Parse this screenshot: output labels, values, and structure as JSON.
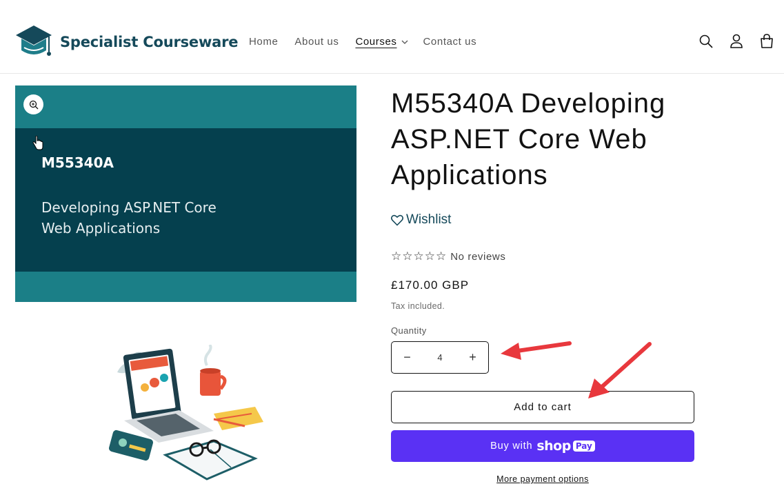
{
  "header": {
    "brand": "Specialist Courseware",
    "nav": [
      {
        "label": "Home"
      },
      {
        "label": "About us"
      },
      {
        "label": "Courses"
      },
      {
        "label": "Contact us"
      }
    ],
    "icons": [
      "search-icon",
      "account-icon",
      "cart-icon"
    ]
  },
  "media": {
    "course_code": "M55340A",
    "course_title": "Developing ASP.NET Core Web Applications",
    "colors": {
      "outer": "#1b7f87",
      "band": "#05404e"
    }
  },
  "product": {
    "title": "M55340A Developing ASP.NET Core Web Applications",
    "wishlist_label": "Wishlist",
    "reviews_text": "No reviews",
    "rating": 0,
    "rating_max": 5,
    "price": "£170.00 GBP",
    "tax_note": "Tax included.",
    "quantity_label": "Quantity",
    "quantity_value": "4",
    "decrease_symbol": "−",
    "increase_symbol": "+",
    "add_to_cart": "Add to cart",
    "buy_with": "Buy with",
    "shop_logo": "shop",
    "pay_badge": "Pay",
    "more_payment": "More payment options"
  },
  "colors": {
    "brand": "#15495a",
    "shop_pay": "#5a31f4",
    "annotation_arrow": "#e8383d"
  }
}
